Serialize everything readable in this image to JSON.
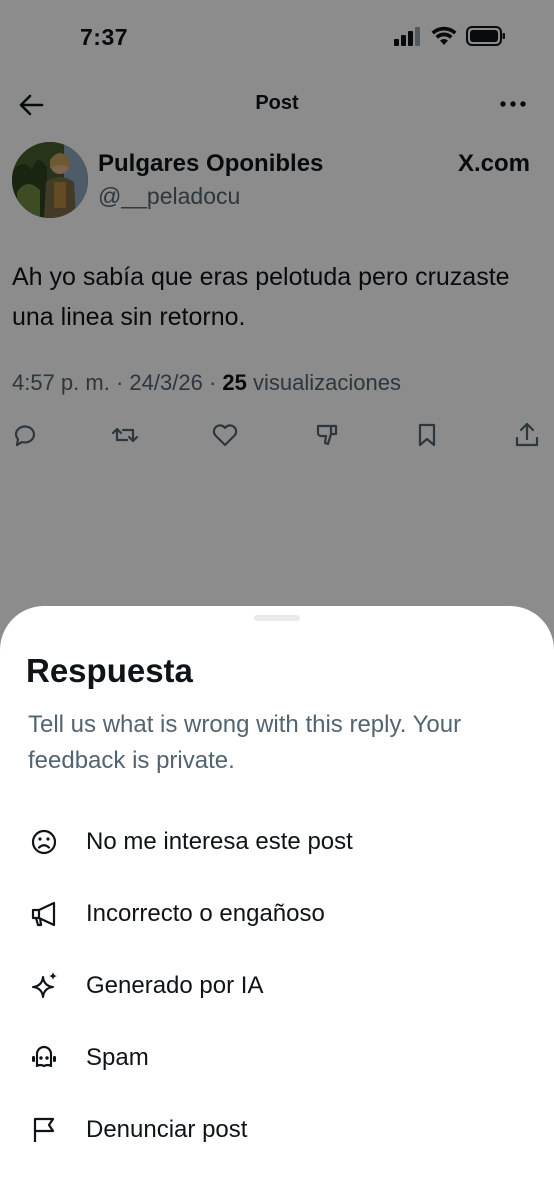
{
  "status_bar": {
    "time": "7:37"
  },
  "nav": {
    "title": "Post"
  },
  "post": {
    "author_name": "Pulgares Oponibles",
    "author_handle": "@__peladocu",
    "source_badge": "X.com",
    "text": "Ah yo sabía que eras pelotuda pero cruzaste una linea sin retorno.",
    "time": "4:57 p. m.",
    "separator": "·",
    "date": "24/3/26",
    "views_count": "25",
    "views_label": "visualizaciones"
  },
  "icons": {
    "actions": [
      "reply-icon",
      "repost-icon",
      "like-icon",
      "dislike-icon",
      "bookmark-icon",
      "share-icon"
    ]
  },
  "sheet": {
    "title": "Respuesta",
    "description": "Tell us what is wrong with this reply. Your feedback is private.",
    "options": [
      {
        "label": "No me interesa este post",
        "icon": "sad-face-icon"
      },
      {
        "label": "Incorrecto o engañoso",
        "icon": "megaphone-icon"
      },
      {
        "label": "Generado por IA",
        "icon": "sparkle-icon"
      },
      {
        "label": "Spam",
        "icon": "robot-icon"
      },
      {
        "label": "Denunciar post",
        "icon": "flag-icon"
      }
    ]
  },
  "colors": {
    "text_primary": "#0f1419",
    "text_secondary": "#536471",
    "overlay": "rgba(0,0,0,0.45)",
    "sheet_bg": "#ffffff"
  }
}
